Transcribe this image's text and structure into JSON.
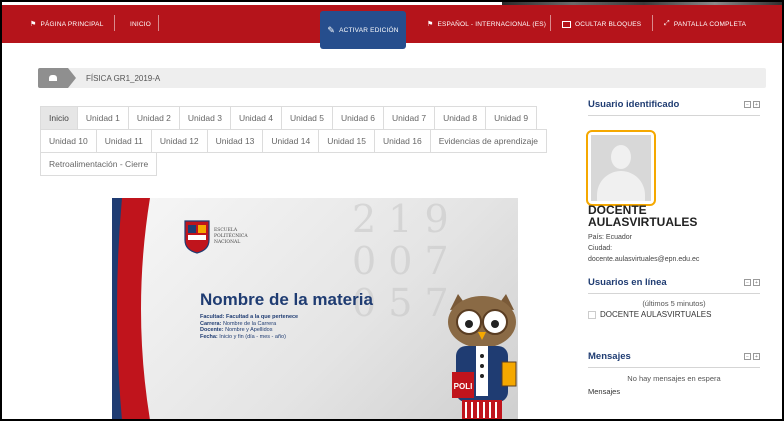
{
  "topbar": {
    "home": "PÁGINA PRINCIPAL",
    "inicio": "INICIO",
    "activar_edicion": "Activar edición",
    "idioma": "ESPAÑOL - INTERNACIONAL (ES)",
    "ocultar_bloques": "OCULTAR BLOQUES",
    "pantalla_completa": "PANTALLA COMPLETA"
  },
  "breadcrumb": {
    "course": "FÍSICA GR1_2019-A"
  },
  "tabs": {
    "row1": [
      "Inicio",
      "Unidad 1",
      "Unidad 2",
      "Unidad 3",
      "Unidad 4",
      "Unidad 5",
      "Unidad 6",
      "Unidad 7",
      "Unidad 8",
      "Unidad 9"
    ],
    "row2": [
      "Unidad 10",
      "Unidad 11",
      "Unidad 12",
      "Unidad 13",
      "Unidad 14",
      "Unidad 15",
      "Unidad 16",
      "Evidencias de aprendizaje"
    ],
    "row3": [
      "Retroalimentación - Cierre"
    ]
  },
  "banner": {
    "logo_line1": "ESCUELA",
    "logo_line2": "POLITÉCNICA",
    "logo_line3": "NACIONAL",
    "title": "Nombre de la materia",
    "facultad_label": "Facultad:",
    "facultad_value": "Facultad a la que pertenece",
    "carrera_label": "Carrera:",
    "carrera_value": "Nombre de la Carrera",
    "docente_label": "Docente:",
    "docente_value": "Nombre y Apellidos",
    "fecha_label": "Fecha:",
    "fecha_value": "Inicio y fin (día - mes - año)",
    "mascot_text": "POLI"
  },
  "user_block": {
    "title": "Usuario identificado",
    "name_line1": "DOCENTE",
    "name_line2": "AULASVIRTUALES",
    "pais": "País: Ecuador",
    "ciudad": "Ciudad:",
    "email": "docente.aulasvirtuales@epn.edu.ec"
  },
  "online_block": {
    "title": "Usuarios en línea",
    "subtitle": "(últimos 5 minutos)",
    "user": "DOCENTE AULASVIRTUALES"
  },
  "messages_block": {
    "title": "Mensajes",
    "empty": "No hay mensajes en espera",
    "link": "Mensajes"
  },
  "colors": {
    "topbar": "#b5141b",
    "edit_button": "#264e8d",
    "highlight": "#f5a800",
    "title_blue": "#1f3c72"
  }
}
